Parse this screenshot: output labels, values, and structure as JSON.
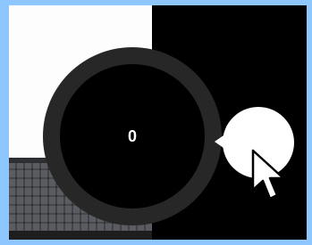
{
  "dial": {
    "value": "0"
  },
  "icons": {
    "cursor": "mouse-pointer-icon",
    "handle": "dial-handle-icon"
  },
  "colors": {
    "background_frame": "#8ec6ff",
    "dial_ring": "#272727",
    "dial_center": "#000000",
    "handle": "#ffffff",
    "text": "#ffffff"
  }
}
